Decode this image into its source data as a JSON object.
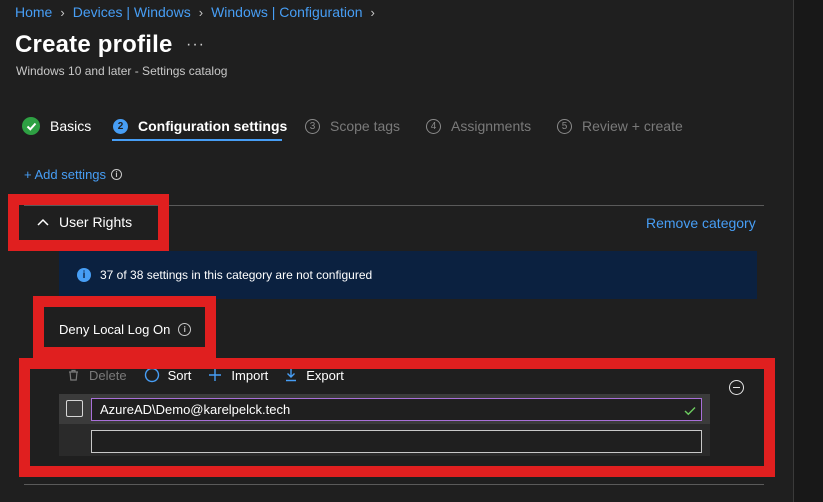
{
  "breadcrumb": {
    "items": [
      "Home",
      "Devices | Windows",
      "Windows | Configuration"
    ]
  },
  "header": {
    "title": "Create profile",
    "more_label": "···",
    "subtitle": "Windows 10 and later - Settings catalog"
  },
  "wizard": {
    "steps": [
      {
        "number": "",
        "label": "Basics",
        "state": "done"
      },
      {
        "number": "2",
        "label": "Configuration settings",
        "state": "current"
      },
      {
        "number": "3",
        "label": "Scope tags",
        "state": "disabled"
      },
      {
        "number": "4",
        "label": "Assignments",
        "state": "disabled"
      },
      {
        "number": "5",
        "label": "Review + create",
        "state": "disabled"
      }
    ]
  },
  "add_settings_label": "+ Add settings",
  "category": {
    "name": "User Rights",
    "remove_label": "Remove category",
    "info_text": "37 of 38 settings in this category are not configured"
  },
  "setting": {
    "name": "Deny Local Log On",
    "toolbar": {
      "delete_label": "Delete",
      "sort_label": "Sort",
      "import_label": "Import",
      "export_label": "Export"
    },
    "values": [
      "AzureAD\\Demo@karelpelck.tech"
    ],
    "new_value_placeholder": ""
  },
  "colors": {
    "accent": "#479ef5",
    "highlight": "#e01f1f",
    "success": "#2ea043",
    "banner": "#0b2140"
  }
}
